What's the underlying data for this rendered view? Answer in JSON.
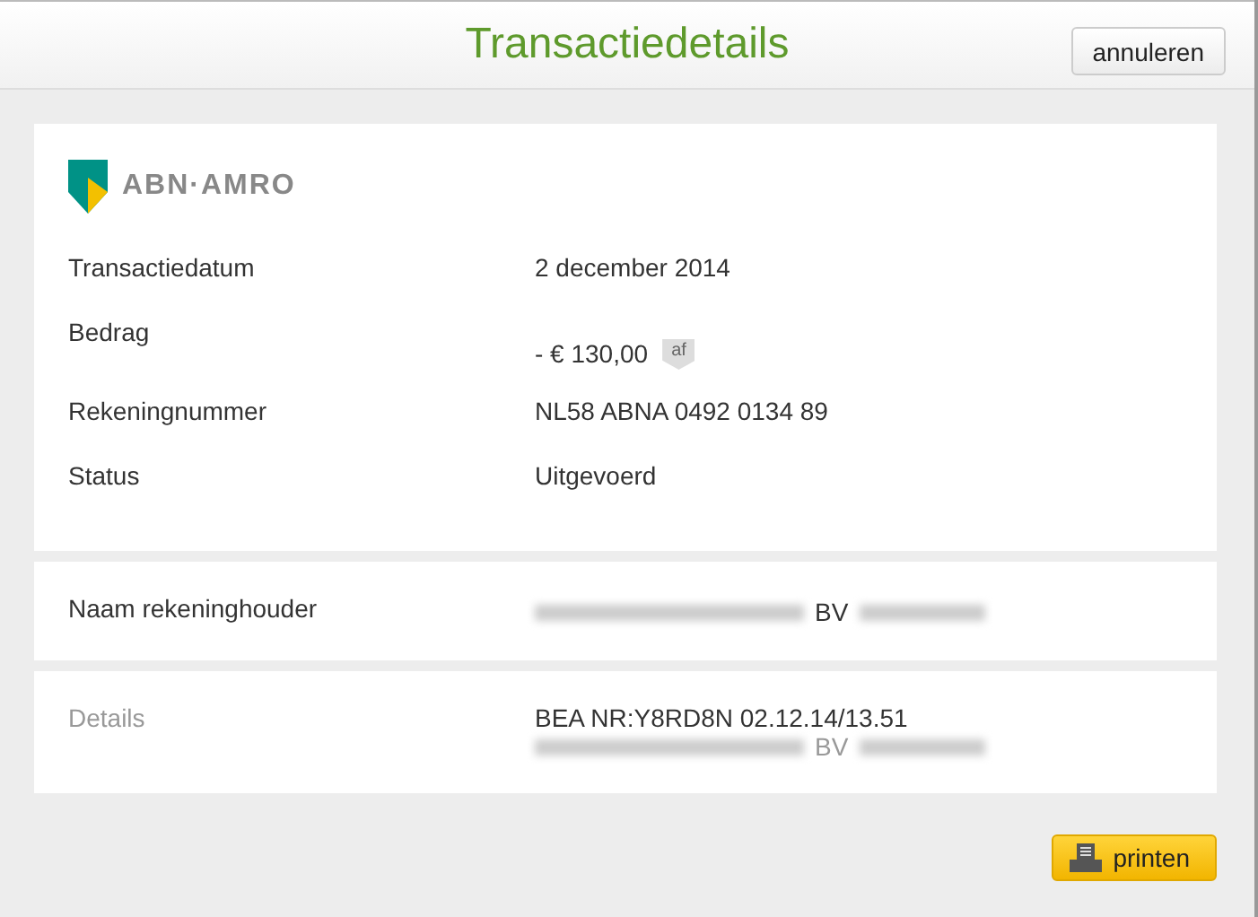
{
  "header": {
    "title": "Transactiedetails",
    "cancel_button": "annuleren"
  },
  "bank": {
    "name": "ABN·AMRO"
  },
  "main_rows": [
    {
      "label": "Transactiedatum",
      "value": "2 december 2014"
    },
    {
      "label": "Bedrag",
      "value": "- € 130,00",
      "tag": "af"
    },
    {
      "label": "Rekeningnummer",
      "value": "NL58 ABNA 0492 0134 89"
    },
    {
      "label": "Status",
      "value": "Uitgevoerd"
    }
  ],
  "holder": {
    "label": "Naam rekeninghouder",
    "visible_part": "BV"
  },
  "details": {
    "label": "Details",
    "line": "BEA NR:Y8RD8N 02.12.14/13.51",
    "visible_part": "BV"
  },
  "print_button": "printen"
}
